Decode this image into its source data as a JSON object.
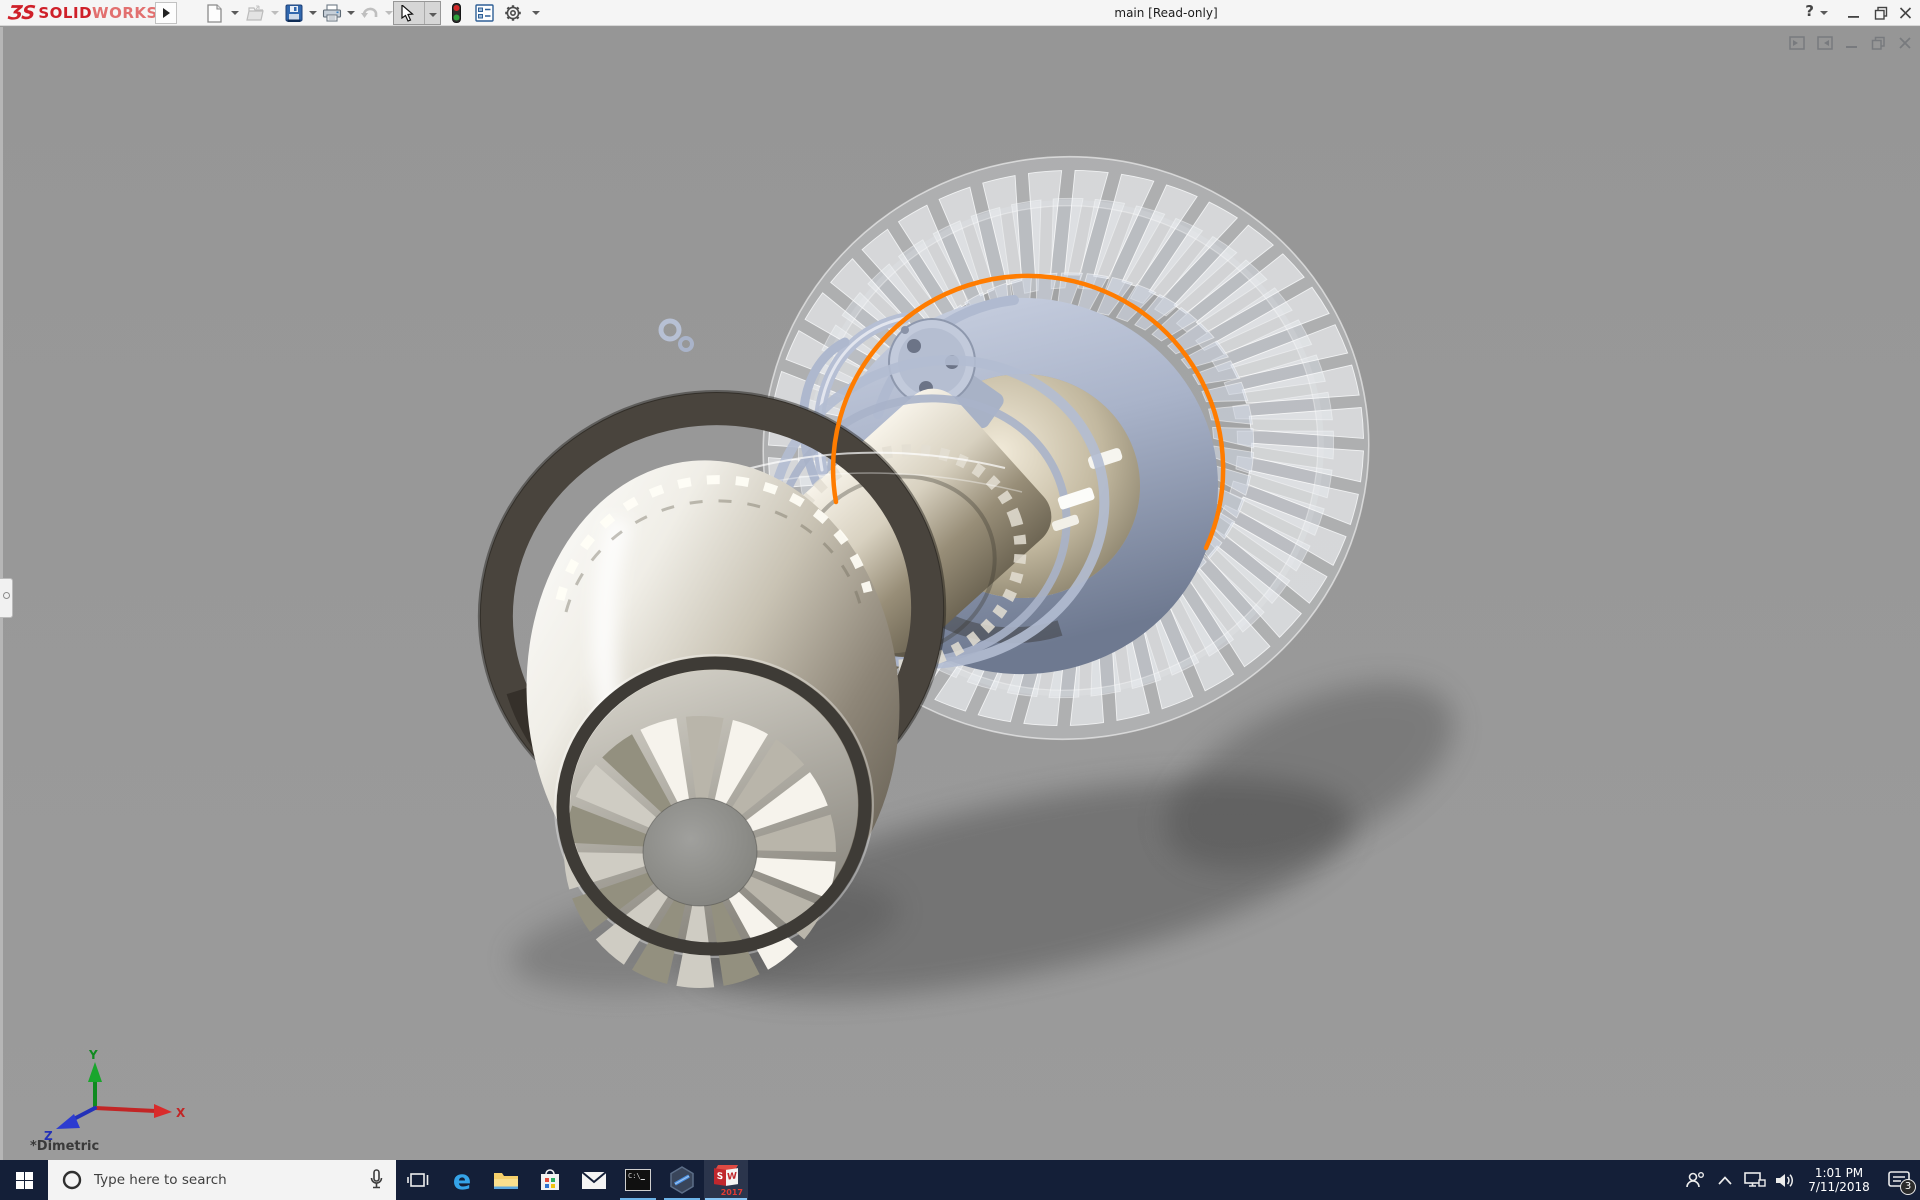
{
  "colors": {
    "accent_orange": "#ff7c00",
    "logo_red": "#cf2029",
    "taskbar_bg": "#141f38",
    "running_underline": "#6db3e8"
  },
  "titlebar": {
    "logo": {
      "mark": "ƷS",
      "bold": "SOLID",
      "light": "WORKS"
    },
    "title": "main [Read-only]",
    "help_label": "?"
  },
  "toolbar": {
    "icons": [
      {
        "name": "new-document-icon",
        "enabled": true
      },
      {
        "name": "open-folder-icon",
        "enabled": false
      },
      {
        "name": "save-icon",
        "enabled": true
      },
      {
        "name": "print-icon",
        "enabled": true
      },
      {
        "name": "undo-icon",
        "enabled": false
      },
      {
        "name": "select-cursor-icon",
        "enabled": true,
        "pressed": true
      },
      {
        "name": "status-light-icon",
        "enabled": true
      },
      {
        "name": "feature-list-icon",
        "enabled": true
      },
      {
        "name": "options-gear-icon",
        "enabled": true
      }
    ]
  },
  "viewport": {
    "view_name": "*Dimetric",
    "triad": {
      "x_label": "X",
      "y_label": "Y",
      "z_label": "Z"
    }
  },
  "taskbar": {
    "search_placeholder": "Type here to search",
    "cmd_label": "C:\\",
    "solidworks_badge": {
      "s": "S",
      "w": "W",
      "year": "2017"
    },
    "tray": {
      "time": "1:01 PM",
      "date": "7/11/2018",
      "notification_count": "3"
    }
  }
}
